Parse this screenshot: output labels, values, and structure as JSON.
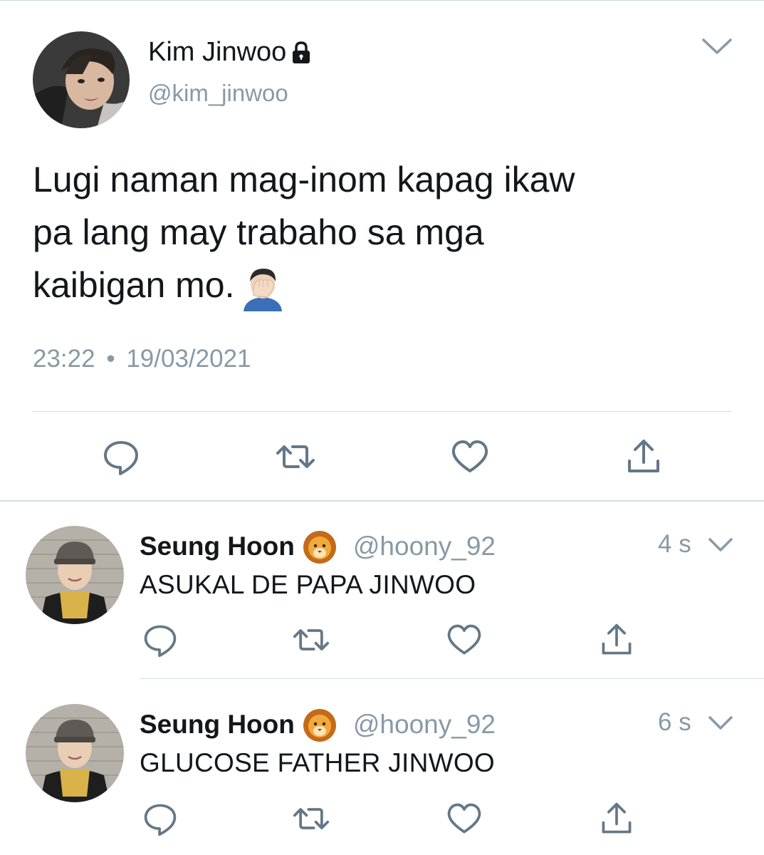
{
  "main_tweet": {
    "display_name": "Kim Jinwoo",
    "handle": "@kim_jinwoo",
    "text_line1": "Lugi naman mag-inom kapag ikaw",
    "text_line2": "pa lang may trabaho sa mga",
    "text_line3": "kaibigan mo.",
    "time": "23:22",
    "separator": "•",
    "date": "19/03/2021",
    "icons": [
      "lock-icon",
      "face-palm-emoji",
      "chevron-down-icon",
      "reply-icon",
      "retweet-icon",
      "like-icon",
      "share-icon"
    ]
  },
  "replies": [
    {
      "display_name": "Seung Hoon",
      "badge": "lion-emoji",
      "handle": "@hoony_92",
      "time": "4 s",
      "text": "ASUKAL DE PAPA JINWOO"
    },
    {
      "display_name": "Seung Hoon",
      "badge": "lion-emoji",
      "handle": "@hoony_92",
      "time": "6 s",
      "text": "GLUCOSE FATHER JINWOO"
    }
  ],
  "colors": {
    "text_primary": "#14171a",
    "text_secondary": "#8899a6",
    "icon_gray": "#657786",
    "divider": "#d4dbe0"
  }
}
